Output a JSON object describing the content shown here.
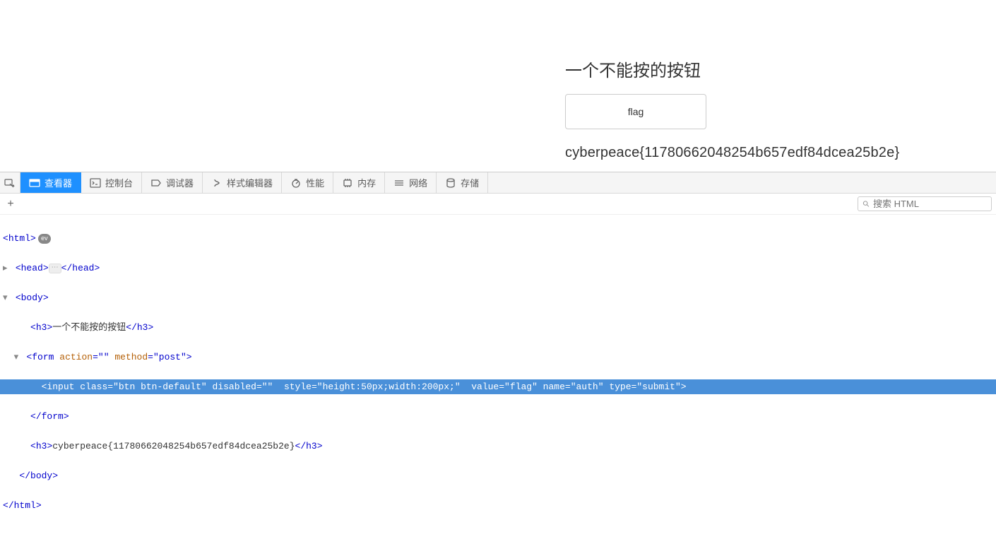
{
  "page": {
    "heading": "一个不能按的按钮",
    "button_value": "flag",
    "flag": "cyberpeace{11780662048254b657edf84dcea25b2e}"
  },
  "devtools": {
    "tabs": {
      "inspector": "查看器",
      "console": "控制台",
      "debugger": "调试器",
      "styles": "样式编辑器",
      "performance": "性能",
      "memory": "内存",
      "network": "网络",
      "storage": "存储"
    },
    "search_placeholder": "搜索 HTML",
    "ev_badge": "ev",
    "dom": {
      "html_open": "html",
      "head_open": "head",
      "head_close": "/head",
      "body_open": "body",
      "h3_open": "h3",
      "h3_text": "一个不能按的按钮",
      "h3_close": "/h3",
      "form_open_tag": "form",
      "form_action_attr": "action",
      "form_action_val": "",
      "form_method_attr": "method",
      "form_method_val": "post",
      "input_tag": "input",
      "input_class_attr": "class",
      "input_class_val": "btn btn-default",
      "input_disabled_attr": "disabled",
      "input_disabled_val": "",
      "input_style_attr": "style",
      "input_style_val": "height:50px;width:200px;",
      "input_value_attr": "value",
      "input_value_val": "flag",
      "input_name_attr": "name",
      "input_name_val": "auth",
      "input_type_attr": "type",
      "input_type_val": "submit",
      "form_close": "/form",
      "h3b_open": "h3",
      "h3b_text": "cyberpeace{11780662048254b657edf84dcea25b2e}",
      "h3b_close": "/h3",
      "body_close": "/body",
      "html_close": "/html"
    }
  }
}
